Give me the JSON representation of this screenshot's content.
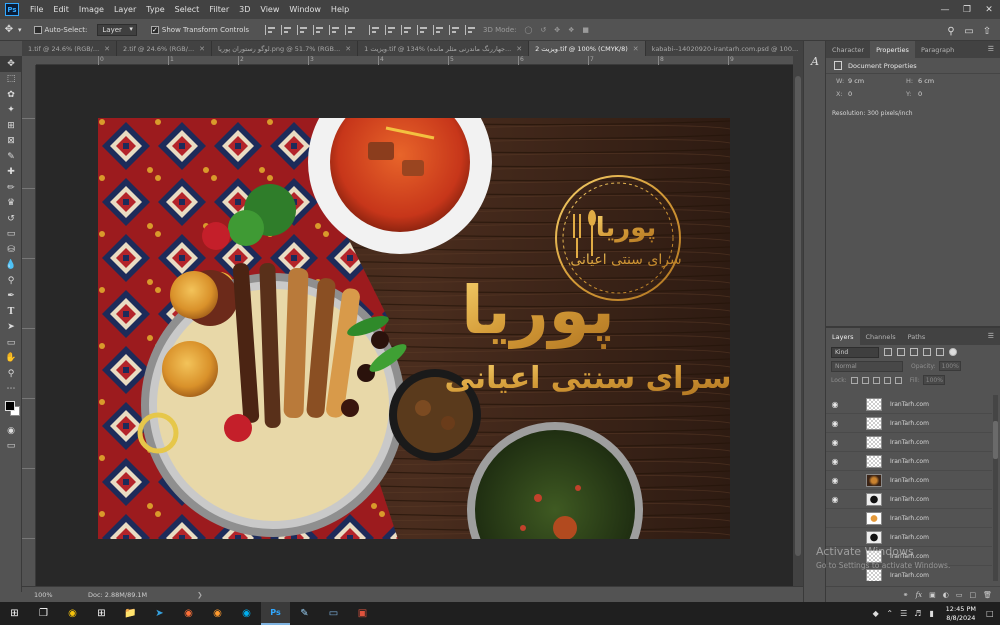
{
  "menubar": {
    "logo": "Ps",
    "items": [
      "File",
      "Edit",
      "Image",
      "Layer",
      "Type",
      "Select",
      "Filter",
      "3D",
      "View",
      "Window",
      "Help"
    ]
  },
  "options": {
    "auto_select_label": "Auto-Select:",
    "auto_select_value": "Layer",
    "show_transform_label": "Show Transform Controls",
    "mode_3d_label": "3D Mode:"
  },
  "tabs": [
    {
      "label": "1.tif @ 24.6% (RGB/..."
    },
    {
      "label": "2.tif @ 24.6% (RGB/..."
    },
    {
      "label": "لوگو رستوران پوریا.png @ 51.7% (RGB..."
    },
    {
      "label": "1 ویزیت.tif @ 134% (جهاررنگ ماندرنی مثلر مانده..."
    },
    {
      "label": "2 ویزیت.tif @ 100% (CMYK/8)"
    },
    {
      "label": "kababi--14020920-irantarh.com.psd @ 100..."
    }
  ],
  "active_tab_index": 4,
  "ruler_ticks": [
    "0",
    "1",
    "2",
    "3",
    "4",
    "5",
    "6",
    "7",
    "8",
    "9"
  ],
  "artwork": {
    "logo_main": "پوریا",
    "logo_sub": "سرای سنتی اعیانی",
    "title_main": "پوریا",
    "title_sub": "سرای سنتی اعیانی"
  },
  "status": {
    "zoom": "100%",
    "doc": "Doc: 2.88M/89.1M"
  },
  "properties_panel": {
    "tabs": [
      "Character",
      "Properties",
      "Paragraph"
    ],
    "active_tab": "Properties",
    "title": "Document Properties",
    "w_label": "W:",
    "w_value": "9 cm",
    "h_label": "H:",
    "h_value": "6 cm",
    "x_label": "X:",
    "x_value": "0",
    "y_label": "Y:",
    "y_value": "0",
    "resolution": "Resolution: 300 pixels/inch"
  },
  "layers_panel": {
    "tabs": [
      "Layers",
      "Channels",
      "Paths"
    ],
    "active_tab": "Layers",
    "kind_label": "Kind",
    "blend_mode": "Normal",
    "opacity_label": "Opacity:",
    "opacity_value": "100%",
    "lock_label": "Lock:",
    "fill_label": "Fill:",
    "fill_value": "100%",
    "layers": [
      {
        "name": "IranTarh.com",
        "visible": true,
        "thumb": "transparent"
      },
      {
        "name": "IranTarh.com",
        "visible": true,
        "thumb": "transparent"
      },
      {
        "name": "IranTarh.com",
        "visible": true,
        "thumb": "transparent"
      },
      {
        "name": "IranTarh.com",
        "visible": true,
        "thumb": "transparent"
      },
      {
        "name": "IranTarh.com",
        "visible": true,
        "thumb": "food"
      },
      {
        "name": "IranTarh.com",
        "visible": true,
        "thumb": "dark"
      },
      {
        "name": "IranTarh.com",
        "visible": false,
        "thumb": "orange"
      },
      {
        "name": "IranTarh.com",
        "visible": false,
        "thumb": "dark"
      },
      {
        "name": "IranTarh.com",
        "visible": false,
        "thumb": "transparent"
      },
      {
        "name": "IranTarh.com",
        "visible": false,
        "thumb": "transparent"
      }
    ]
  },
  "watermark": {
    "line1": "Activate Windows",
    "line2": "Go to Settings to activate Windows."
  },
  "taskbar": {
    "time": "12:45 PM",
    "date": "8/8/2024"
  },
  "colors": {
    "foreground": "#000000",
    "background": "#ffffff",
    "gold": "#d9a441"
  }
}
